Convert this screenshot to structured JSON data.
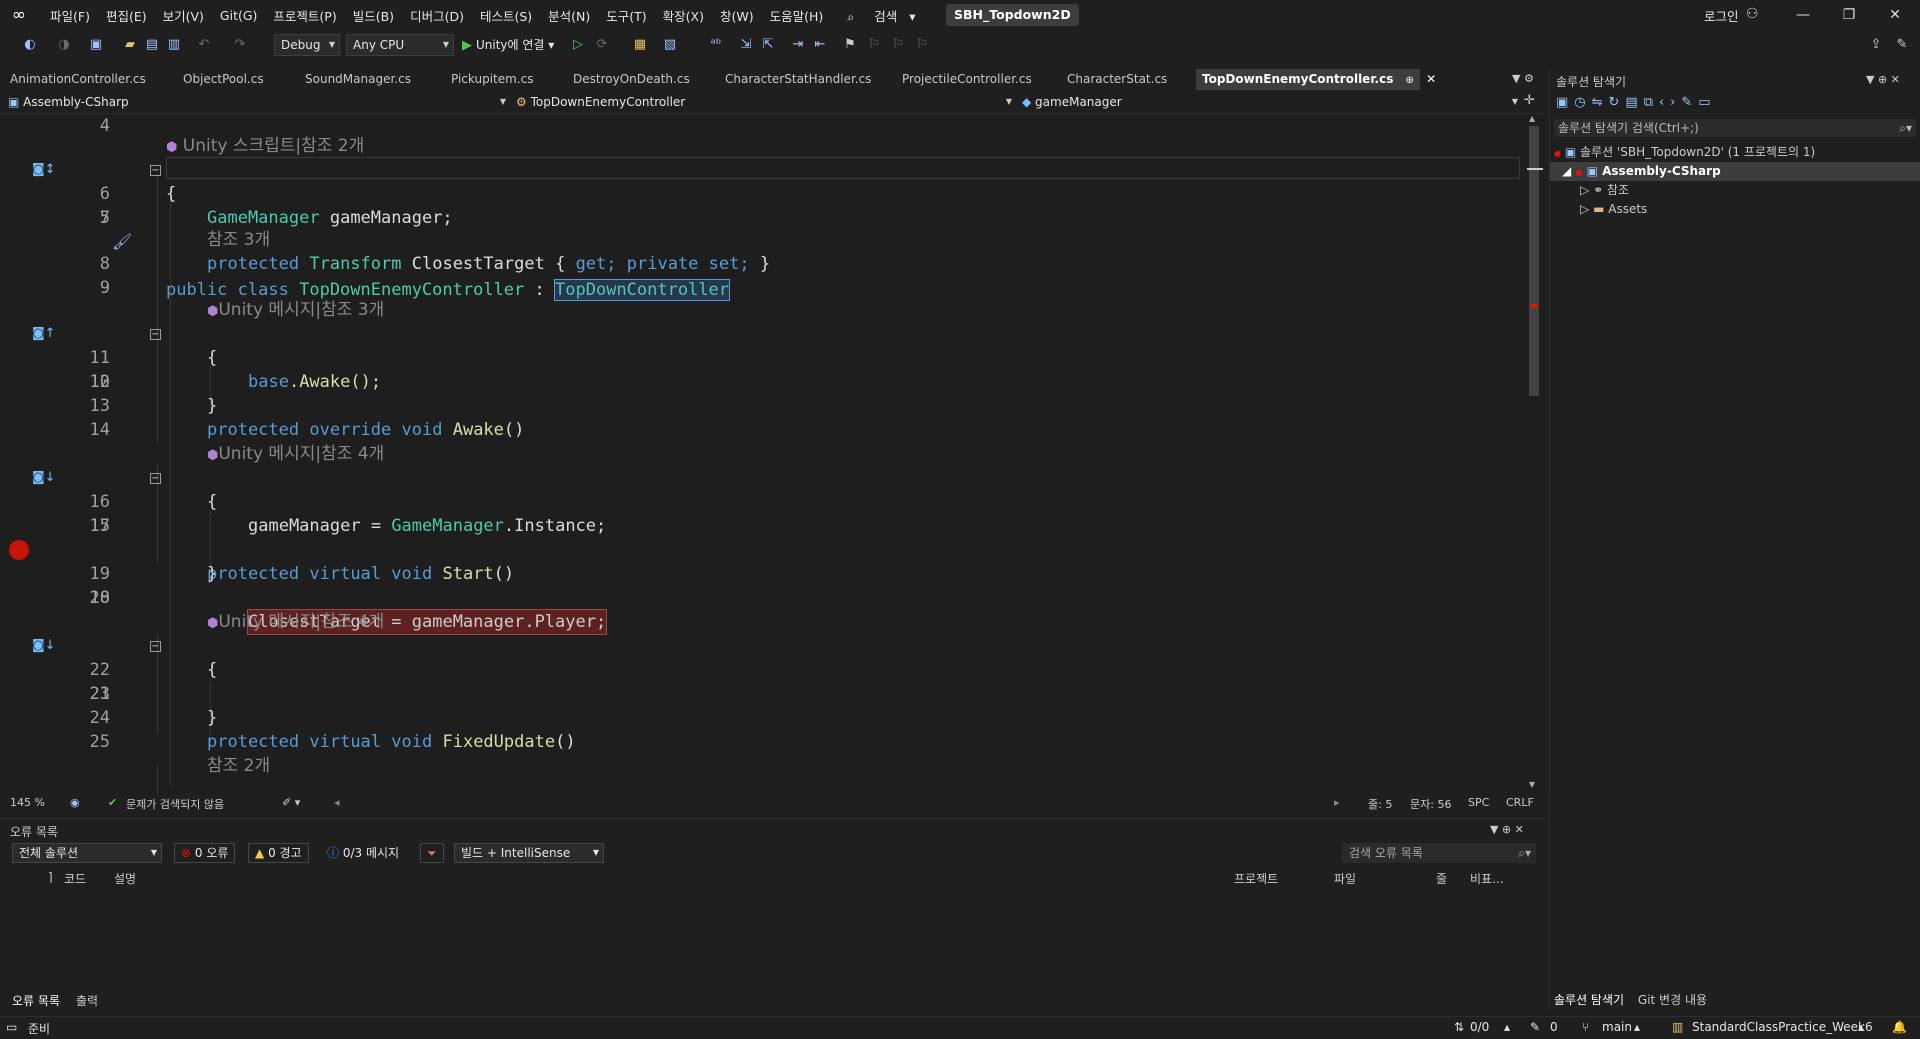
{
  "menu": [
    "파일(F)",
    "편집(E)",
    "보기(V)",
    "Git(G)",
    "프로젝트(P)",
    "빌드(B)",
    "디버그(D)",
    "테스트(S)",
    "분석(N)",
    "도구(T)",
    "확장(X)",
    "창(W)",
    "도움말(H)"
  ],
  "search_label": "검색",
  "solution_name": "SBH_Topdown2D",
  "login_label": "로그인",
  "toolbar": {
    "config": "Debug",
    "platform": "Any CPU",
    "run_label": "Unity에 연결"
  },
  "tabs": [
    "AnimationController.cs",
    "ObjectPool.cs",
    "SoundManager.cs",
    "Pickupitem.cs",
    "DestroyOnDeath.cs",
    "CharacterStatHandler.cs",
    "ProjectileController.cs",
    "CharacterStat.cs",
    "TopDownEnemyController.cs"
  ],
  "nav": {
    "project": "Assembly-CSharp",
    "type": "TopDownEnemyController",
    "member": "gameManager"
  },
  "code": {
    "l4": "4",
    "lens_unity_script": "Unity 스크립트|참조 2개",
    "l5": "5",
    "l6": "6",
    "l7": "7",
    "l8": "8",
    "l9": "9",
    "l10": "10",
    "l11": "11",
    "l12": "12",
    "l13": "13",
    "l14": "14",
    "l15": "15",
    "l16": "16",
    "l17": "17",
    "l18": "18",
    "l19": "19",
    "l20": "20",
    "l21": "21",
    "l22": "22",
    "l23": "23",
    "l24": "24",
    "l25": "25",
    "lens_ref3": "참조 3개",
    "lens_msg3": "Unity 메시지|참조 3개",
    "lens_msg4a": "Unity 메시지|참조 4개",
    "lens_msg4b": "Unity 메시지|참조 4개",
    "lens_ref2": "참조 2개",
    "kw_public": "public",
    "kw_class": "class",
    "class_name": "TopDownEnemyController",
    "colon": ":",
    "base_class": "TopDownController",
    "brace_open": "{",
    "brace_close": "}",
    "t_gamemanager": "GameManager",
    "f_gamemanager": "gameManager;",
    "kw_protected": "protected",
    "t_transform": "Transform",
    "p_closest": "ClosestTarget",
    "accessor_open": "{",
    "kw_get": "get;",
    "kw_private": "private",
    "kw_set": "set;",
    "accessor_close": "}",
    "kw_override": "override",
    "kw_void": "void",
    "kw_virtual": "virtual",
    "m_awake": "Awake",
    "m_start": "Start",
    "m_fixedupdate": "FixedUpdate",
    "parens": "()",
    "kw_base": "base",
    "base_call": ".Awake();",
    "assign1_lhs": "gameManager =",
    "assign1_type": "GameManager",
    "assign1_rhs": ".Instance;",
    "breakpoint_line": "ClosestTarget = gameManager.Player;"
  },
  "editor_status": {
    "zoom": "145 %",
    "issues": "문제가 검색되지 않음",
    "line": "줄: 5",
    "col": "문자: 56",
    "spc": "SPC",
    "crlf": "CRLF"
  },
  "error_list": {
    "title": "오류 목록",
    "scope": "전체 솔루션",
    "errors": "0 오류",
    "warnings": "0 경고",
    "messages": "0/3 메시지",
    "build": "빌드 + IntelliSense",
    "search_placeholder": "검색 오류 목록",
    "columns": [
      "코드",
      "설명",
      "프로젝트",
      "파일",
      "줄",
      "비표..."
    ]
  },
  "bottom_tabs": [
    "오류 목록",
    "출력"
  ],
  "solution_explorer": {
    "title": "솔루션 탐색기",
    "search": "솔루션 탐색기 검색(Ctrl+;)",
    "solution": "솔루션 'SBH_Topdown2D' (1 프로젝트의 1)",
    "project": "Assembly-CSharp",
    "references": "참조",
    "assets": "Assets",
    "tabs": [
      "솔루션 탐색기",
      "Git 변경 내용"
    ]
  },
  "statusbar": {
    "ready": "준비",
    "updown": "0/0",
    "pencil": "0",
    "branch": "main",
    "repo": "StandardClassPractice_Week6"
  },
  "colors": {
    "keyword": "#569cd6",
    "type": "#4ec9b0",
    "method": "#dcdcaa",
    "breakpoint": "#e51400",
    "background": "#1e1e1e"
  }
}
